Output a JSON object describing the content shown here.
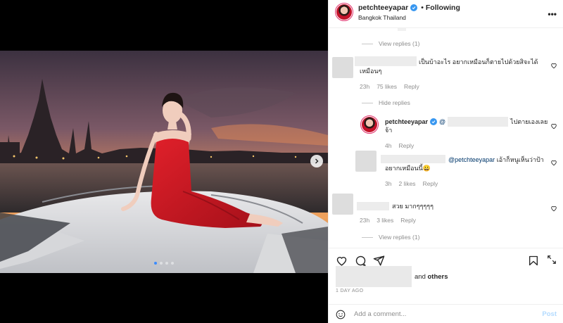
{
  "header": {
    "username": "petchteeyapar",
    "separator": "•",
    "follow_label": "Following",
    "location": "Bangkok Thailand",
    "more_icon": "more-horizontal-icon"
  },
  "comments": {
    "top_partial_view_replies": "View replies (1)",
    "items": [
      {
        "text_visible": "เป็นบ้าอะไร อยากเหมือนก็ตายไปด้วยสิจะได้เหมือนๆ",
        "text_line1": "เป็นบ้าอะไร อยากเหมือนก็ตายไปด้วยสิจะได้",
        "text_line2": "เหมือนๆ",
        "time": "23h",
        "likes": "75 likes",
        "reply": "Reply",
        "toggle": "Hide replies"
      },
      {
        "mention": "@",
        "text_line1": "ไปตายเองเลย",
        "text_line2": "จ้า",
        "time": "4h",
        "reply": "Reply"
      },
      {
        "mention": "@petchteeyapar",
        "text_line1": "เอ้าก็หนูเห็นว่าป้า",
        "text_line2": "อยากเหมือนนี้😀",
        "time": "3h",
        "likes": "2 likes",
        "reply": "Reply"
      },
      {
        "text": "สวย มากๆๆๆๆๆ",
        "time": "23h",
        "likes": "3 likes",
        "reply": "Reply",
        "toggle": "View replies (1)"
      }
    ]
  },
  "actions": {
    "icons": [
      "heart-icon",
      "comment-icon",
      "share-icon",
      "bookmark-icon"
    ],
    "likes_suffix": "and",
    "likes_others": "others",
    "time_ago": "1 DAY AGO"
  },
  "add_comment": {
    "placeholder": "Add a comment...",
    "post_label": "Post"
  },
  "carousel": {
    "current_index": 1,
    "total": 4
  }
}
